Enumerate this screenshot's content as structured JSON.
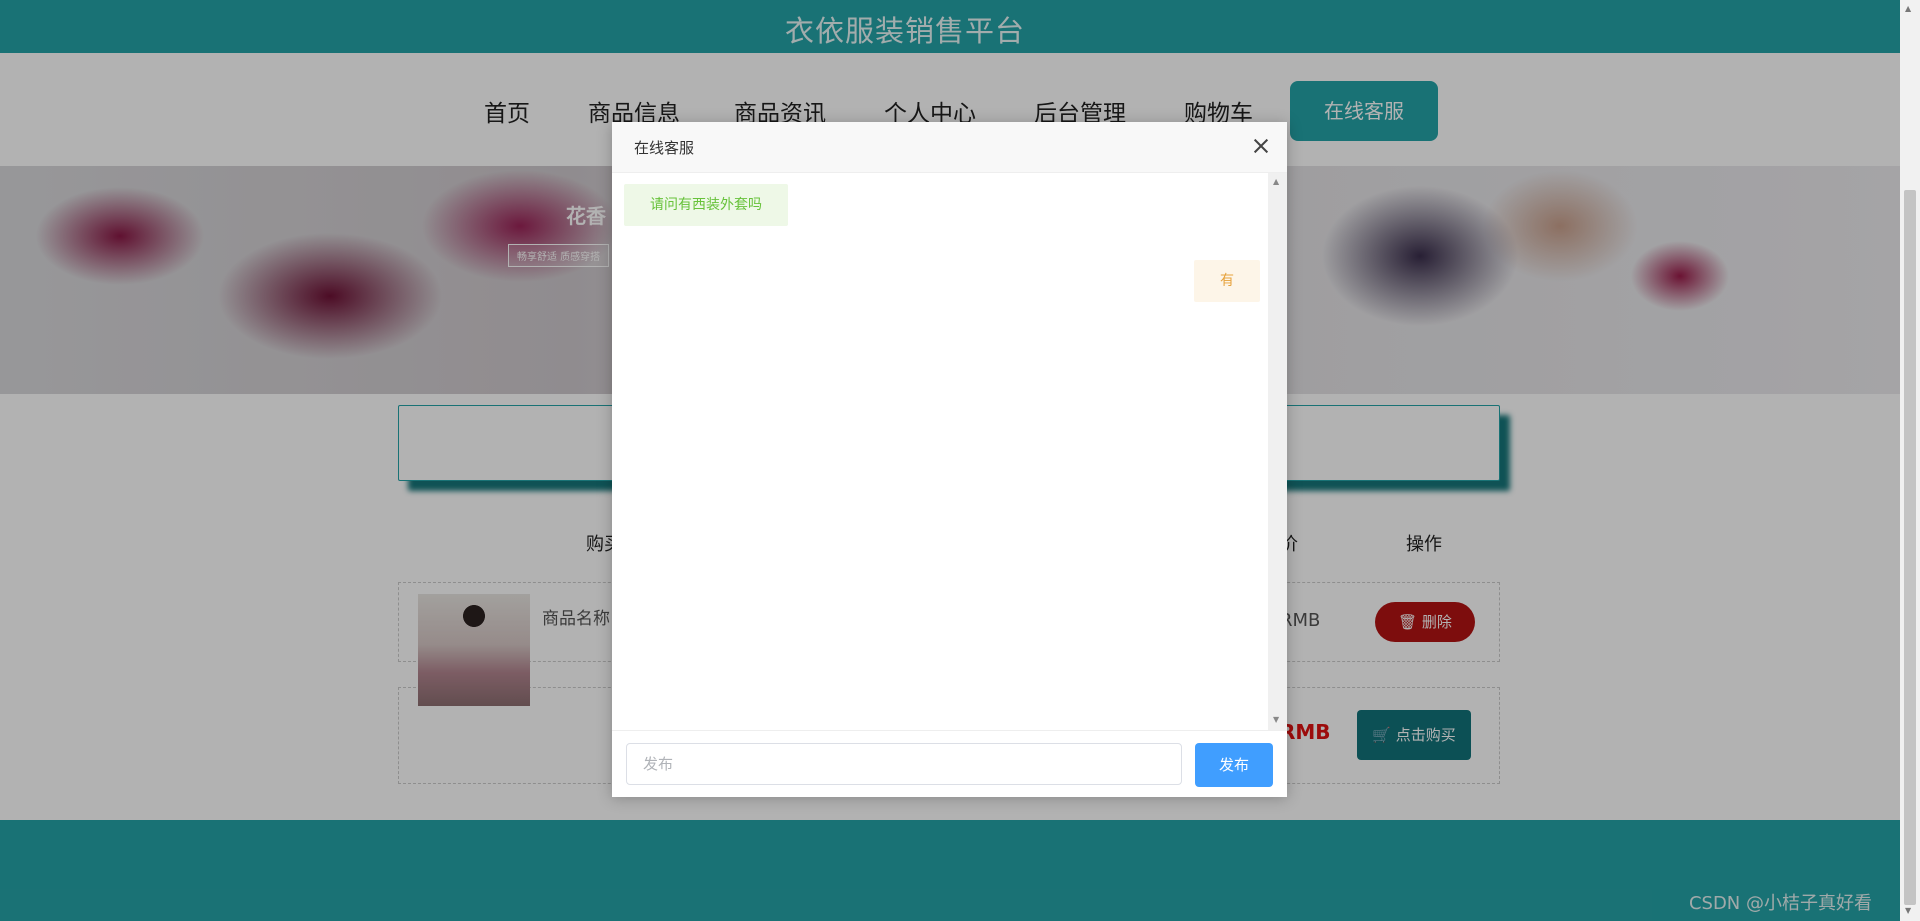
{
  "site": {
    "title": "衣依服装销售平台"
  },
  "nav": {
    "items": [
      "首页",
      "商品信息",
      "商品资讯",
      "个人中心",
      "后台管理",
      "购物车"
    ],
    "customer_service": "在线客服"
  },
  "banner": {
    "text": "花香",
    "subtext": "畅享舒适 质感穿搭"
  },
  "cart": {
    "headers": [
      "购买",
      "价",
      "操作"
    ],
    "row1": {
      "name": "商品名称",
      "price": "RMB",
      "action": "删除"
    },
    "row2": {
      "price": "RMB",
      "action": "点击购买"
    }
  },
  "dialog": {
    "title": "在线客服",
    "messages": [
      {
        "side": "left",
        "text": "请问有西装外套吗"
      },
      {
        "side": "right",
        "text": "有"
      }
    ],
    "input_placeholder": "发布",
    "send_label": "发布"
  },
  "watermark": "CSDN @小桔子真好看",
  "colors": {
    "primary": "#25a4a8",
    "send": "#409eff",
    "delete": "#b31414",
    "buy": "#12737a",
    "price": "#e01010"
  },
  "icons": {
    "close": "close-icon",
    "delete": "trash-icon",
    "buy": "cart-icon"
  }
}
